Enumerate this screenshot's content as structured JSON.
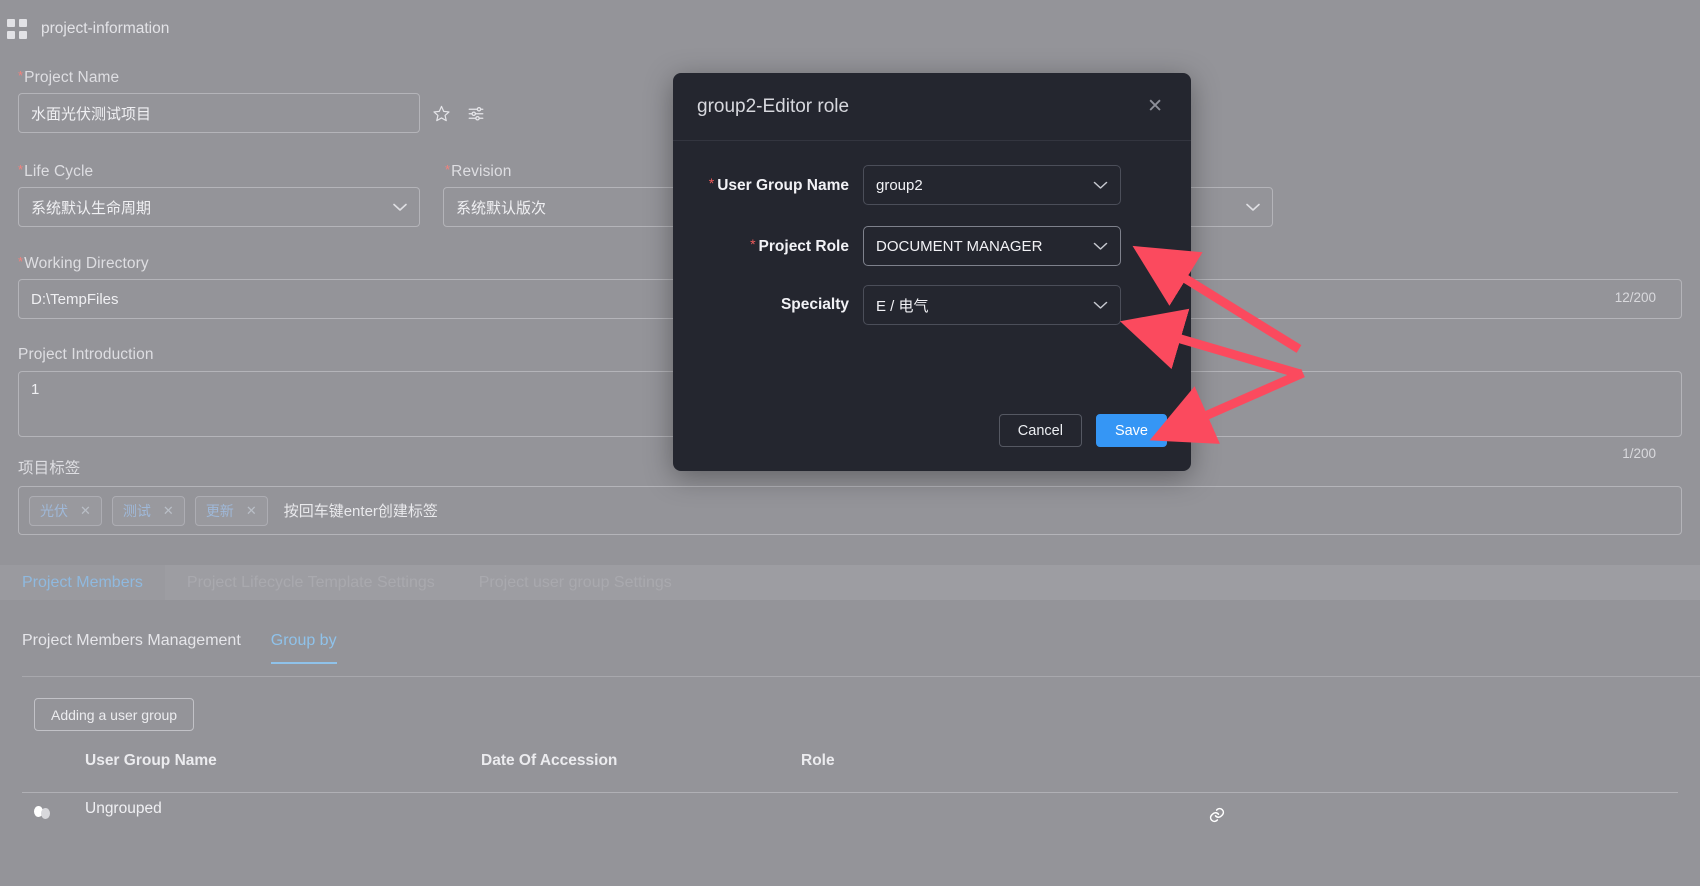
{
  "breadcrumb": {
    "icon": "grid-icon",
    "label": "project-information"
  },
  "form": {
    "project_name": {
      "label": "Project Name",
      "required": true,
      "value": "水面光伏测试项目"
    },
    "favorite_icon": "star-icon",
    "settings_icon": "sliders-icon",
    "life_cycle": {
      "label": "Life Cycle",
      "required": true,
      "value": "系统默认生命周期"
    },
    "revision": {
      "label": "Revision",
      "required": true,
      "value": "系统默认版次"
    },
    "working_directory": {
      "label": "Working Directory",
      "required": true,
      "value": "D:\\TempFiles",
      "counter": "12/200"
    },
    "project_introduction": {
      "label": "Project Introduction",
      "required": false,
      "value": "1",
      "counter": "1/200"
    },
    "project_tags": {
      "label": "项目标签",
      "tags": [
        "光伏",
        "测试",
        "更新"
      ],
      "remove_icon": "close-icon",
      "placeholder": "按回车键enter创建标签"
    }
  },
  "tabs": {
    "items": [
      {
        "label": "Project Members",
        "active": true
      },
      {
        "label": "Project Lifecycle Template Settings",
        "active": false
      },
      {
        "label": "Project user group Settings",
        "active": false
      }
    ]
  },
  "sub_tabs": {
    "items": [
      {
        "label": "Project Members Management",
        "active": false
      },
      {
        "label": "Group by",
        "active": true
      }
    ]
  },
  "toolbar": {
    "add_group_label": "Adding a user group"
  },
  "table": {
    "columns": [
      "User Group Name",
      "Date Of Accession",
      "Role"
    ],
    "rows": [
      {
        "group_icon": "users-icon",
        "name": "Ungrouped",
        "date": "",
        "role": "",
        "action_icon": "link-icon"
      }
    ]
  },
  "modal": {
    "title": "group2-Editor role",
    "close_icon": "close-icon",
    "fields": [
      {
        "label": "User Group Name",
        "required": true,
        "value": "group2",
        "chevron": "chevron-down-icon"
      },
      {
        "label": "Project Role",
        "required": true,
        "value": "DOCUMENT MANAGER",
        "chevron": "chevron-down-icon"
      },
      {
        "label": "Specialty",
        "required": false,
        "value": "E / 电气",
        "chevron": "chevron-down-icon"
      }
    ],
    "cancel_label": "Cancel",
    "save_label": "Save"
  },
  "annotations": {
    "arrow_color": "#fb4a5e",
    "count": 3
  },
  "colors": {
    "page_bg": "#949499",
    "modal_bg": "#24262f",
    "accent": "#3596f5",
    "required": "#ef5b5b",
    "tab_active": "#8fc2ea"
  }
}
